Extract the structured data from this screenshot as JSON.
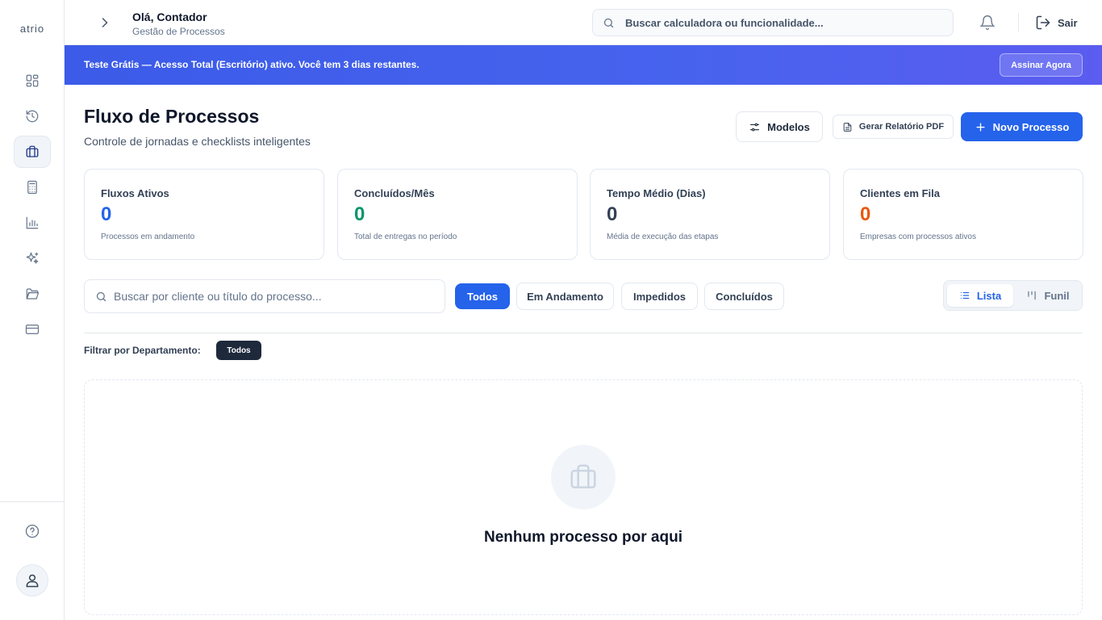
{
  "sidebar": {
    "logo": "atrio",
    "items": [
      {
        "name": "dashboard",
        "icon": "grid-icon"
      },
      {
        "name": "history",
        "icon": "history-icon"
      },
      {
        "name": "processes",
        "icon": "briefcase-icon",
        "active": true
      },
      {
        "name": "calculators",
        "icon": "calculator-icon"
      },
      {
        "name": "reports",
        "icon": "bar-chart-icon"
      },
      {
        "name": "ai",
        "icon": "sparkles-icon"
      },
      {
        "name": "files",
        "icon": "folder-icon"
      },
      {
        "name": "billing",
        "icon": "credit-card-icon"
      }
    ]
  },
  "header": {
    "greeting": "Olá, Contador",
    "subtitle": "Gestão de Processos",
    "search_placeholder": "Buscar calculadora ou funcionalidade...",
    "logout_label": "Sair"
  },
  "banner": {
    "text": "Teste Grátis — Acesso Total (Escritório) ativo. Você tem 3 dias restantes.",
    "button_label": "Assinar Agora"
  },
  "page": {
    "title": "Fluxo de Processos",
    "subtitle": "Controle de jornadas e checklists inteligentes",
    "btn_modelos": "Modelos",
    "btn_pdf": "Gerar Relatório PDF",
    "btn_novo": "Novo Processo"
  },
  "stats": [
    {
      "label": "Fluxos Ativos",
      "value": "0",
      "desc": "Processos em andamento",
      "color": "#2563eb"
    },
    {
      "label": "Concluídos/Mês",
      "value": "0",
      "desc": "Total de entregas no período",
      "color": "#059669"
    },
    {
      "label": "Tempo Médio (Dias)",
      "value": "0",
      "desc": "Média de execução das etapas",
      "color": "#334155"
    },
    {
      "label": "Clientes em Fila",
      "value": "0",
      "desc": "Empresas com processos ativos",
      "color": "#ea580c"
    }
  ],
  "filters": {
    "search_placeholder": "Buscar por cliente ou título do processo...",
    "status": [
      "Todos",
      "Em Andamento",
      "Impedidos",
      "Concluídos"
    ],
    "active_status": "Todos",
    "view_list": "Lista",
    "view_funnel": "Funil",
    "dept_label": "Filtrar por Departamento:",
    "dept_active": "Todos"
  },
  "empty": {
    "title": "Nenhum processo por aqui"
  },
  "colors": {
    "accent": "#2563eb",
    "banner_start": "#3b5be8",
    "banner_end": "#5b5cf0"
  }
}
